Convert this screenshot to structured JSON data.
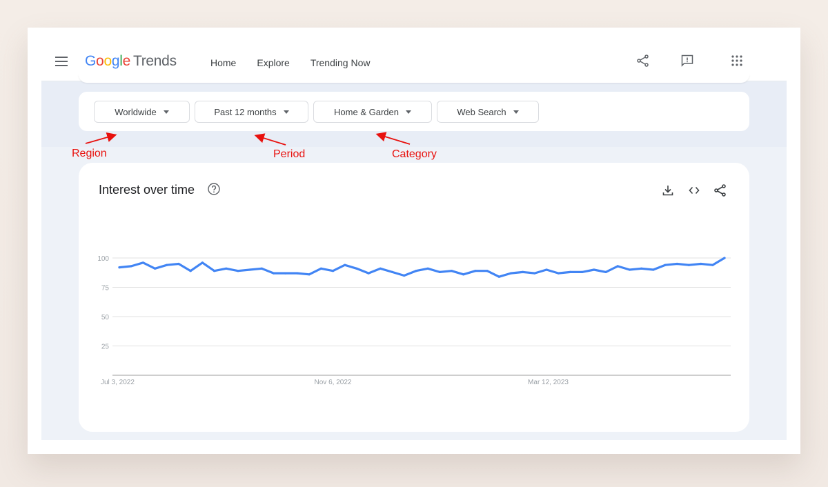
{
  "app": {
    "logo_google": [
      "G",
      "o",
      "o",
      "g",
      "l",
      "e"
    ],
    "logo_product": "Trends",
    "nav": [
      {
        "label": "Home",
        "active": false
      },
      {
        "label": "Explore",
        "active": true
      },
      {
        "label": "Trending Now",
        "active": false
      }
    ],
    "top_icons": [
      "share-icon",
      "feedback-icon",
      "apps-grid-icon"
    ]
  },
  "filters": [
    {
      "label": "Worldwide",
      "annotation": "Region"
    },
    {
      "label": "Past 12 months",
      "annotation": "Period"
    },
    {
      "label": "Home & Garden",
      "annotation": "Category"
    },
    {
      "label": "Web Search",
      "annotation": null
    }
  ],
  "annotations": {
    "region": "Region",
    "period": "Period",
    "category": "Category",
    "color": "#e8110e"
  },
  "card": {
    "title": "Interest over time",
    "help_icon": "help-circle-icon",
    "actions": [
      "download-icon",
      "embed-code-icon",
      "share-icon"
    ]
  },
  "colors": {
    "line": "#4285f4",
    "accent": "#4285f4"
  },
  "chart_data": {
    "type": "line",
    "title": "Interest over time",
    "xlabel": "",
    "ylabel": "",
    "ylim": [
      0,
      100
    ],
    "yticks": [
      25,
      50,
      75,
      100
    ],
    "x_tick_labels": [
      {
        "label": "Jul 3, 2022",
        "index": 0
      },
      {
        "label": "Nov 6, 2022",
        "index": 18
      },
      {
        "label": "Mar 12, 2023",
        "index": 36
      }
    ],
    "grid": true,
    "legend": "none",
    "series": [
      {
        "name": "Home & Garden",
        "values": [
          92,
          93,
          96,
          91,
          94,
          95,
          89,
          96,
          89,
          91,
          89,
          90,
          91,
          87,
          87,
          87,
          86,
          91,
          89,
          94,
          91,
          87,
          91,
          88,
          85,
          89,
          91,
          88,
          89,
          86,
          89,
          89,
          84,
          87,
          88,
          87,
          90,
          87,
          88,
          88,
          90,
          88,
          93,
          90,
          91,
          90,
          94,
          95,
          94,
          95,
          94,
          100
        ]
      }
    ]
  }
}
